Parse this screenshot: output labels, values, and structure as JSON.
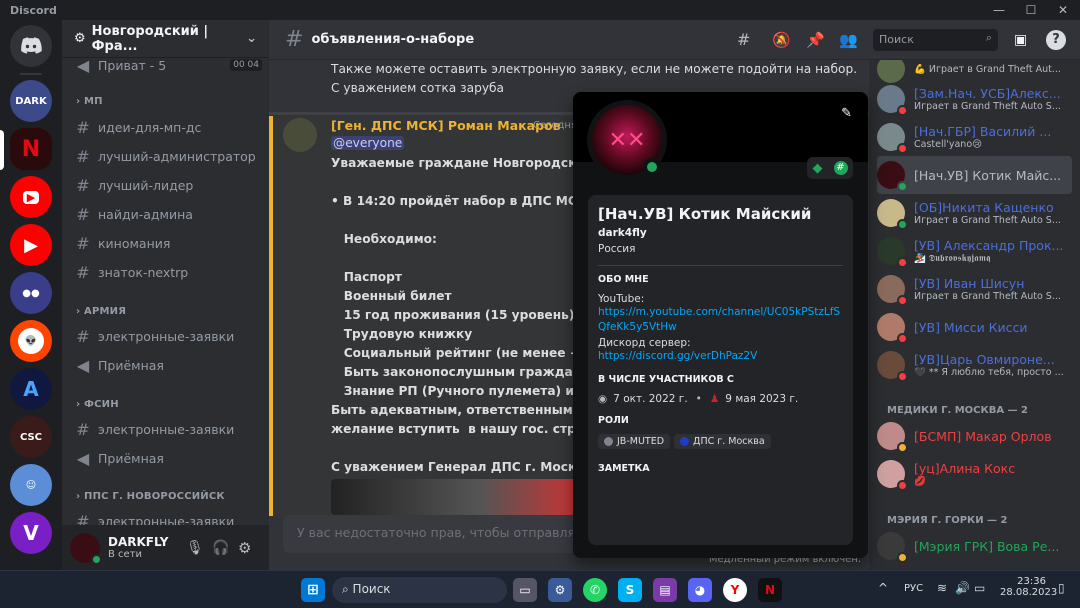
{
  "app": {
    "title": "Discord"
  },
  "server": {
    "name": "Новгородский | Фра..."
  },
  "sidebar": {
    "top_item": "Приват - 5",
    "top_item_counts": "00 04",
    "categories": [
      {
        "name": "МП",
        "channels": [
          {
            "label": "идеи-для-мп-дс",
            "type": "text"
          },
          {
            "label": "лучший-администратор",
            "type": "text"
          },
          {
            "label": "лучший-лидер",
            "type": "text"
          },
          {
            "label": "найди-админа",
            "type": "text"
          },
          {
            "label": "киномания",
            "type": "text"
          },
          {
            "label": "знаток-nextrp",
            "type": "text"
          }
        ]
      },
      {
        "name": "АРМИЯ",
        "channels": [
          {
            "label": "электронные-заявки",
            "type": "text"
          },
          {
            "label": "Приёмная",
            "type": "voice"
          }
        ]
      },
      {
        "name": "ФСИН",
        "channels": [
          {
            "label": "электронные-заявки",
            "type": "text"
          },
          {
            "label": "Приёмная",
            "type": "voice"
          }
        ]
      },
      {
        "name": "ППС Г. НОВОРОССИЙСК",
        "channels": [
          {
            "label": "электронные-заявки",
            "type": "text"
          }
        ]
      }
    ]
  },
  "user_panel": {
    "name": "DARKFLY",
    "status": "В сети"
  },
  "channel": {
    "name": "объявления-о-наборе",
    "search_placeholder": "Поиск"
  },
  "messages": {
    "prev_lines": [
      "Также можете оставить электронную заявку, если не можете подойти на набор.",
      "С уважением сотка заруба"
    ],
    "author": "[Ген. ДПС МСК] Роман Макаров",
    "timestamp": "Сегодня,",
    "mention": "@everyone",
    "body": [
      "Уважаемые граждане Новгородского",
      "",
      "• В 14:20 пройдёт набор в ДПС МСК в Д",
      "",
      "   Необходимо:",
      "",
      "   Паспорт",
      "   Военный билет",
      "   15 год проживания (15 уровень)",
      "   Трудовую книжку",
      "   Социальный рейтинг (не менее +500)",
      "   Быть законопослушным гражданино",
      "   Знание РП (Ручного пулемета) и его с",
      "Быть адекватным, ответственным и ко",
      "желание вступить  в нашу гос. структу",
      "",
      "С уважением Генерал ДПС г. Москва Р"
    ],
    "composer_placeholder": "У вас недостаточно прав, чтобы отправлять со",
    "slowmode": "Медленный режим включён."
  },
  "profile": {
    "display_name": "[Нач.УВ] Котик Майский",
    "username": "dark4fly",
    "pronouns": "Россия",
    "about_title": "ОБО МНЕ",
    "about_lines": [
      "YouTube:"
    ],
    "youtube_link": "https://m.youtube.com/channel/UC05kPStzLfSQfeKk5y5VtHw",
    "discord_label": "Дискорд сервер:",
    "discord_link": "https://discord.gg/verDhPaz2V",
    "member_since_title": "В ЧИСЛЕ УЧАСТНИКОВ С",
    "discord_since": "7 окт. 2022 г.",
    "server_since": "9 мая 2023 г.",
    "roles_title": "РОЛИ",
    "roles": [
      {
        "name": "JB-MUTED",
        "color": "#80848e"
      },
      {
        "name": "ДПС г. Москва",
        "color": "#1f3cc7"
      }
    ],
    "note_title": "ЗАМЕТКА"
  },
  "members": {
    "list": [
      {
        "name": "",
        "status": "💪 Играет в Grand Theft Aut...",
        "color": "#dbdee1"
      },
      {
        "name": "[Зам.Нач. УСБ]Алекс...",
        "status": "Играет в Grand Theft Auto S...",
        "color": "#4c6fd8"
      },
      {
        "name": "[Нач.ГБР] Василий ...",
        "status": "Castell'yano😢",
        "color": "#4c6fd8"
      },
      {
        "name": "[Нач.УВ] Котик Майс...",
        "status": "",
        "color": "#b5bac1"
      },
      {
        "name": "[ОБ]Никита Кащенко",
        "status": "Играет в Grand Theft Auto S...",
        "color": "#4c6fd8"
      },
      {
        "name": "[УВ] Александр Прок...",
        "status": "🏂 𝕯𝖚𝖇𝖗𝖔𝖛𝖘𝖐𝖞𝖏𝖆𝖒𝖖",
        "color": "#4c6fd8"
      },
      {
        "name": "[УВ] Иван Шисун",
        "status": "Играет в Grand Theft Auto S...",
        "color": "#4c6fd8"
      },
      {
        "name": "[УВ] Мисси Кисси",
        "status": "",
        "color": "#4c6fd8"
      },
      {
        "name": "[УВ]Царь Овмироне...",
        "status": "🖤 ** Я люблю тебя, просто ...",
        "color": "#4c6fd8"
      }
    ],
    "cat_medics": "МЕДИКИ Г. МОСКВА — 2",
    "medics": [
      {
        "name": "[БСМП] Макар Орлов",
        "status": "",
        "color": "#f23f43"
      },
      {
        "name": "[уц]Алина Кокс",
        "status": "💋",
        "color": "#f23f43"
      }
    ],
    "cat_mayor": "МЭРИЯ Г. ГОРКИ — 2",
    "mayor": [
      {
        "name": "[Мэрия ГРК] Вова Ре...",
        "status": "",
        "color": "#23a55a"
      }
    ]
  },
  "taskbar": {
    "search": "Поиск",
    "lang": "РУС",
    "time": "23:36",
    "date": "28.08.2023"
  }
}
